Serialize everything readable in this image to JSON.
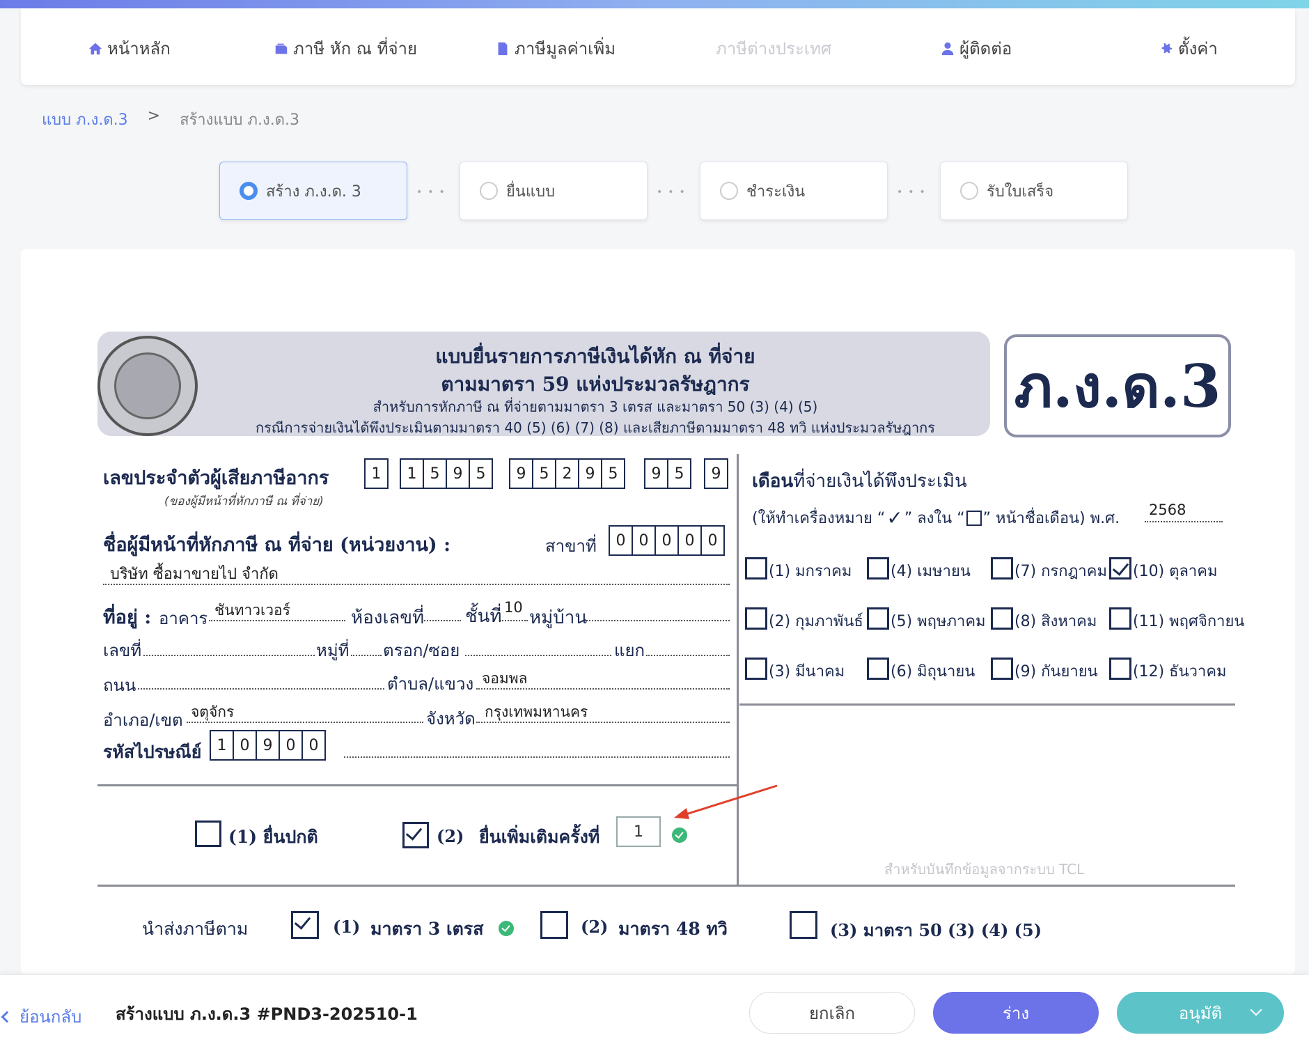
{
  "nav": {
    "home": "หน้าหลัก",
    "withholding": "ภาษี หัก ณ ที่จ่าย",
    "vat": "ภาษีมูลค่าเพิ่ม",
    "foreign_tax": "ภาษีต่างประเทศ",
    "contacts": "ผู้ติดต่อ",
    "settings": "ตั้งค่า"
  },
  "breadcrumb": {
    "parent": "แบบ ภ.ง.ด.3",
    "sep": ">",
    "current": "สร้างแบบ ภ.ง.ด.3"
  },
  "steps": [
    "สร้าง ภ.ง.ด. 3",
    "ยื่นแบบ",
    "ชำระเงิน",
    "รับใบเสร็จ"
  ],
  "form": {
    "title1": "แบบยื่นรายการภาษีเงินได้หัก ณ ที่จ่าย",
    "title2": "ตามมาตรา 59 แห่งประมวลรัษฎากร",
    "sub1": "สำหรับการหักภาษี ณ ที่จ่ายตามมาตรา 3 เตรส และมาตรา 50 (3) (4) (5)",
    "sub2": "กรณีการจ่ายเงินได้พึงประเมินตามมาตรา 40 (5) (6) (7) (8) และเสียภาษีตามมาตรา 48 ทวิ แห่งประมวลรัษฎากร",
    "code": "ภ.ง.ด.3",
    "tax_id_label": "เลขประจำตัวผู้เสียภาษีอากร",
    "tax_id_note": "(ของผู้มีหน้าที่หักภาษี ณ ที่จ่าย)",
    "tax_id": [
      "1",
      "1",
      "5",
      "9",
      "5",
      "9",
      "5",
      "2",
      "9",
      "5",
      "9",
      "5",
      "9"
    ],
    "payer_label": "ชื่อผู้มีหน้าที่หักภาษี ณ ที่จ่าย (หน่วยงาน) :",
    "branch_label": "สาขาที่",
    "branch": [
      "0",
      "0",
      "0",
      "0",
      "0"
    ],
    "payer_name": "บริษัท ซื้อมาขายไป จำกัด",
    "address_label": "ที่อยู่ :",
    "building_label": "อาคาร",
    "building": "ชันทาวเวอร์",
    "room_label": "ห้องเลขที่",
    "floor_label": "ชั้นที่",
    "floor": "10",
    "village_label": "หมู่บ้าน",
    "number_label": "เลขที่",
    "moo_label": "หมู่ที่",
    "soi_label": "ตรอก/ซอย",
    "junction_label": "แยก",
    "road_label": "ถนน",
    "subdistrict_label": "ตำบล/แขวง",
    "subdistrict": "จอมพล",
    "district_label": "อำเภอ/เขต",
    "district": "จตุจักร",
    "province_label": "จังหวัด",
    "province": "กรุงเทพมหานคร",
    "postcode_label": "รหัสไปรษณีย์",
    "postcode": [
      "1",
      "0",
      "9",
      "0",
      "0"
    ],
    "month_title_bold": "เดือน",
    "month_title": "ที่จ่ายเงินได้พึงประเมิน",
    "month_instr_a": "(ให้ทำเครื่องหมาย “",
    "month_instr_b": "” ลงใน “",
    "month_instr_c": "” หน้าชื่อเดือน) พ.ศ.",
    "year": "2568",
    "months": [
      "(1) มกราคม",
      "(4) เมษายน",
      "(7) กรกฎาคม",
      "(10) ตุลาคม",
      "(2) กุมภาพันธ์",
      "(5) พฤษภาคม",
      "(8) สิงหาคม",
      "(11) พฤศจิกายน",
      "(3) มีนาคม",
      "(6) มิถุนายน",
      "(9) กันยายน",
      "(12) ธันวาคม"
    ],
    "filing_normal": "(1) ยื่นปกติ",
    "filing_extra_num": "(2)",
    "filing_extra": "ยื่นเพิ่มเติมครั้งที่",
    "filing_extra_count": "1",
    "tcl_note": "สำหรับบันทึกข้อมูลจากระบบ TCL",
    "remit_label": "นำส่งภาษีตาม",
    "remit_1_num": "(1)",
    "remit_1": "มาตรา 3 เตรส",
    "remit_2_num": "(2)",
    "remit_2": "มาตรา 48 ทวิ",
    "remit_3": "(3) มาตรา 50 (3) (4) (5)"
  },
  "footer": {
    "back": "ย้อนกลับ",
    "title": "สร้างแบบ ภ.ง.ด.3 #PND3-202510-1",
    "cancel": "ยกเลิก",
    "draft": "ร่าง",
    "approve": "อนุมัติ"
  },
  "colors": {
    "accent": "#6c72e8",
    "approve": "#5cc4c8",
    "check": "#3cb878"
  }
}
